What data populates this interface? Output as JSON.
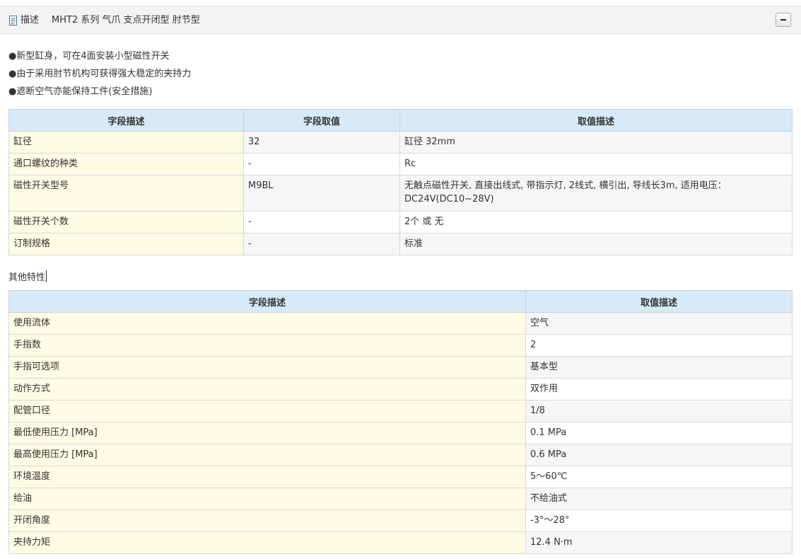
{
  "header": {
    "label": "描述",
    "title": "MHT2 系列 气爪 支点开闭型 肘节型",
    "icon": "document-icon",
    "collapse_icon": "minus-icon"
  },
  "features": [
    "●新型缸身，可在4面安装小型磁性开关",
    "●由于采用肘节机构可获得强大稳定的夹持力",
    "●遮断空气亦能保持工件(安全措施)"
  ],
  "table1": {
    "headers": [
      "字段描述",
      "字段取值",
      "取值描述"
    ],
    "rows": [
      [
        "缸径",
        "32",
        "缸径 32mm"
      ],
      [
        "通口螺纹的种类",
        "-",
        "Rc"
      ],
      [
        "磁性开关型号",
        "M9BL",
        "无触点磁性开关, 直接出线式, 带指示灯, 2线式, 横引出, 导线长3m, 适用电压：DC24V(DC10~28V)"
      ],
      [
        "磁性开关个数",
        "-",
        "2个 或 无"
      ],
      [
        "订制规格",
        "-",
        "标准"
      ]
    ]
  },
  "other": {
    "title": "其他特性",
    "headers": [
      "字段描述",
      "取值描述"
    ],
    "rows": [
      [
        "使用流体",
        "空气"
      ],
      [
        "手指数",
        "2"
      ],
      [
        "手指可选项",
        "基本型"
      ],
      [
        "动作方式",
        "双作用"
      ],
      [
        "配管口径",
        "1/8"
      ],
      [
        "最低使用压力 [MPa]",
        "0.1 MPa"
      ],
      [
        "最高使用压力 [MPa]",
        "0.6 MPa"
      ],
      [
        "环境温度",
        "5～60℃"
      ],
      [
        "给油",
        "不给油式"
      ],
      [
        "开闭角度",
        "-3°～28°"
      ],
      [
        "夹持力矩",
        "12.4 N·m"
      ]
    ]
  }
}
